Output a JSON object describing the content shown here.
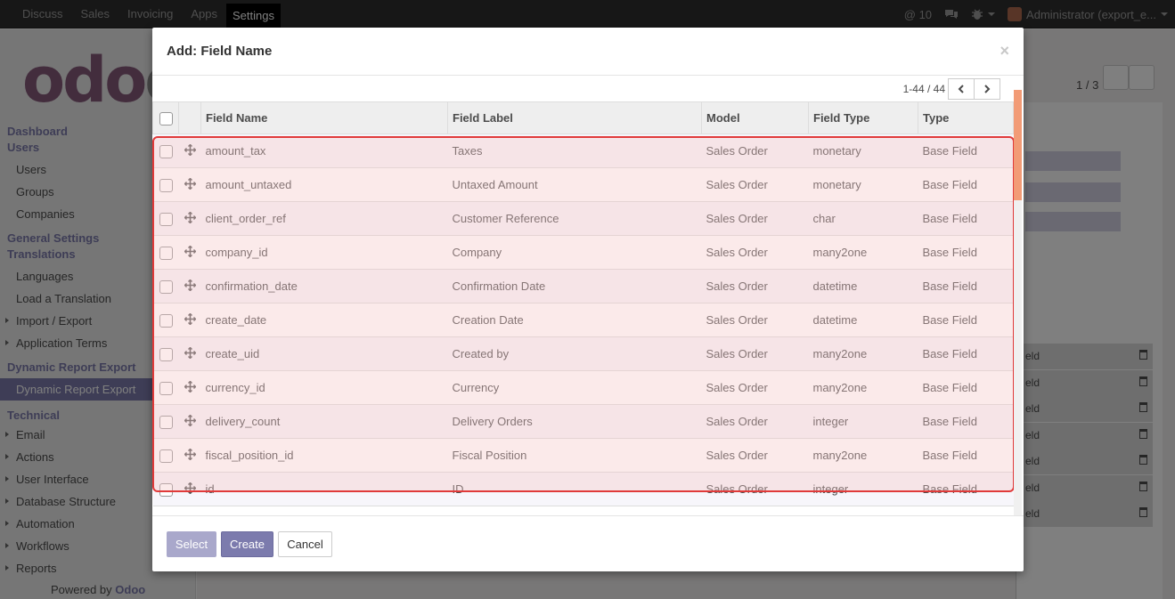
{
  "navbar": {
    "menus": [
      "Discuss",
      "Sales",
      "Invoicing",
      "Apps",
      "Settings"
    ],
    "active_menu": "Settings",
    "notifications": "@ 10",
    "user": "Administrator (export_e..."
  },
  "sidebar": {
    "sections": [
      {
        "title": "Dashboard"
      },
      {
        "title": "Users",
        "items": [
          "Users",
          "Groups",
          "Companies"
        ]
      },
      {
        "title": "General Settings"
      },
      {
        "title": "Translations",
        "items": [
          "Languages",
          "Load a Translation",
          "Import / Export",
          "Application Terms"
        ]
      },
      {
        "title": "Dynamic Report Export",
        "items": [
          "Dynamic Report Export"
        ]
      },
      {
        "title": "Technical",
        "items": [
          "Email",
          "Actions",
          "User Interface",
          "Database Structure",
          "Automation",
          "Workflows",
          "Reports"
        ]
      }
    ],
    "powered_by": "Powered by",
    "powered_brand": "Odoo"
  },
  "background": {
    "pager": "1 / 3",
    "rows": [
      "eld",
      "eld",
      "eld",
      "eld",
      "eld",
      "eld",
      "eld"
    ]
  },
  "modal": {
    "title": "Add: Field Name",
    "close": "×",
    "pager": {
      "value": "1-44 / 44"
    },
    "columns": [
      "Field Name",
      "Field Label",
      "Model",
      "Field Type",
      "Type"
    ],
    "rows": [
      {
        "name": "amount_tax",
        "label": "Taxes",
        "model": "Sales Order",
        "ftype": "monetary",
        "type": "Base Field"
      },
      {
        "name": "amount_untaxed",
        "label": "Untaxed Amount",
        "model": "Sales Order",
        "ftype": "monetary",
        "type": "Base Field"
      },
      {
        "name": "client_order_ref",
        "label": "Customer Reference",
        "model": "Sales Order",
        "ftype": "char",
        "type": "Base Field"
      },
      {
        "name": "company_id",
        "label": "Company",
        "model": "Sales Order",
        "ftype": "many2one",
        "type": "Base Field"
      },
      {
        "name": "confirmation_date",
        "label": "Confirmation Date",
        "model": "Sales Order",
        "ftype": "datetime",
        "type": "Base Field"
      },
      {
        "name": "create_date",
        "label": "Creation Date",
        "model": "Sales Order",
        "ftype": "datetime",
        "type": "Base Field"
      },
      {
        "name": "create_uid",
        "label": "Created by",
        "model": "Sales Order",
        "ftype": "many2one",
        "type": "Base Field"
      },
      {
        "name": "currency_id",
        "label": "Currency",
        "model": "Sales Order",
        "ftype": "many2one",
        "type": "Base Field"
      },
      {
        "name": "delivery_count",
        "label": "Delivery Orders",
        "model": "Sales Order",
        "ftype": "integer",
        "type": "Base Field"
      },
      {
        "name": "fiscal_position_id",
        "label": "Fiscal Position",
        "model": "Sales Order",
        "ftype": "many2one",
        "type": "Base Field"
      },
      {
        "name": "id",
        "label": "ID",
        "model": "Sales Order",
        "ftype": "integer",
        "type": "Base Field"
      }
    ],
    "buttons": {
      "select": "Select",
      "create": "Create",
      "cancel": "Cancel"
    }
  }
}
